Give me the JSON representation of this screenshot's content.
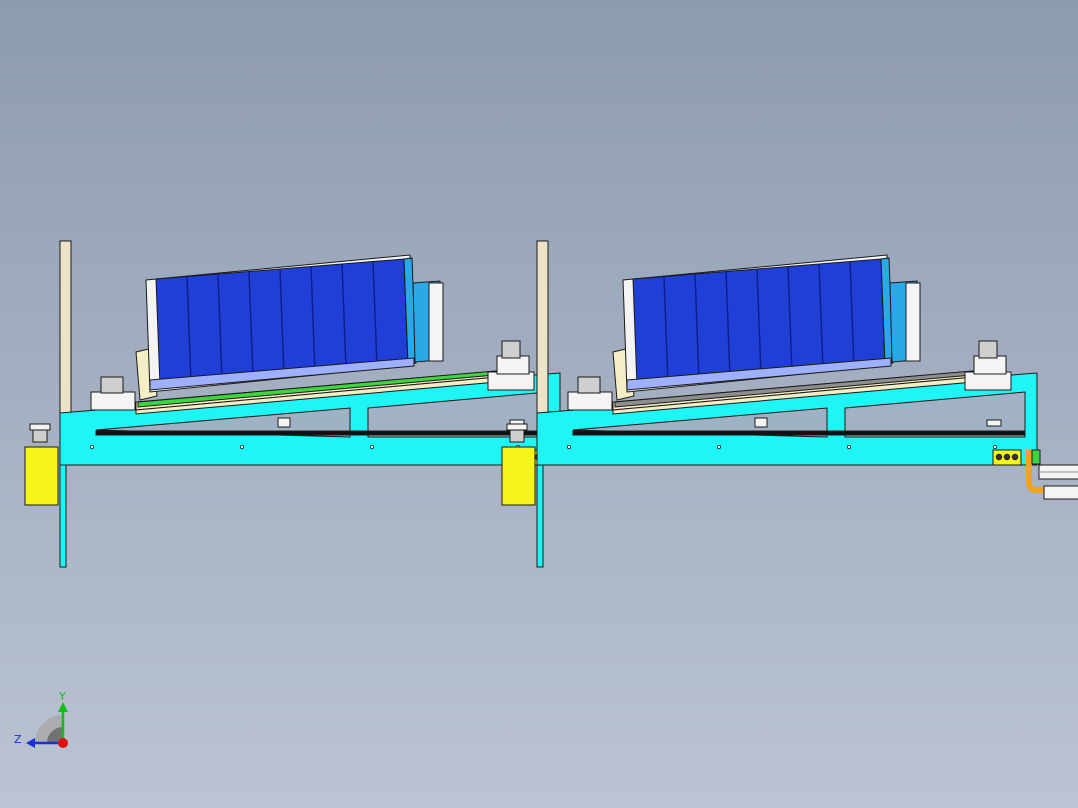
{
  "viewport": {
    "background_top": "#8d9bb0",
    "background_bottom": "#bcc4d3"
  },
  "colors": {
    "outline": "#1a1a1a",
    "frame_cyan": "#1ff5f5",
    "post_beige": "#ede4c8",
    "tray_cream": "#f3eec5",
    "battery_blue": "#1f3fd6",
    "battery_edge": "#0b1e8a",
    "side_light_blue": "#2aa8e8",
    "bracket_white": "#f4f4f4",
    "motor_yellow": "#f5f51a",
    "rail_green": "#3ed63e",
    "rail_gray": "#8e8e8e",
    "base_magenta": "#e632d6",
    "pipe_orange": "#f0a31c",
    "block_gray": "#cfcfcf",
    "end_blue": "#3226d0",
    "triad_x": "#e01010",
    "triad_y": "#10c010",
    "triad_z": "#1a2fd8"
  },
  "modules": [
    {
      "name": "loader-module-left",
      "rail": "green",
      "has_base": false
    },
    {
      "name": "loader-module-right",
      "rail": "gray",
      "has_base": true
    }
  ],
  "triad": {
    "y_label": "Y",
    "z_label": "Z",
    "icon": "coordinate-triad-icon"
  }
}
